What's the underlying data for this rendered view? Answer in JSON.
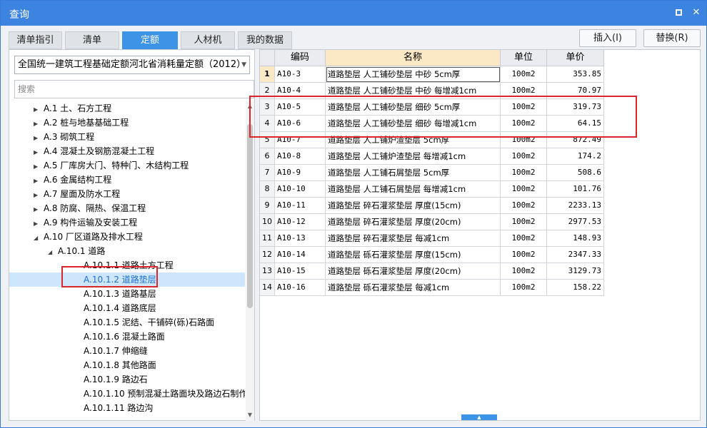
{
  "window": {
    "title": "查询"
  },
  "tabs": [
    {
      "label": "清单指引"
    },
    {
      "label": "清单"
    },
    {
      "label": "定额"
    },
    {
      "label": "人材机"
    },
    {
      "label": "我的数据"
    }
  ],
  "buttons": {
    "insert": "插入(I)",
    "replace": "替换(R)"
  },
  "left": {
    "combo_value": "全国统一建筑工程基础定额河北省消耗量定额（2012）",
    "search_placeholder": "搜索",
    "tree": [
      {
        "label": "A.1 土、石方工程",
        "expand": "collapsed"
      },
      {
        "label": "A.2 桩与地基基础工程",
        "expand": "collapsed"
      },
      {
        "label": "A.3 砌筑工程",
        "expand": "collapsed"
      },
      {
        "label": "A.4 混凝土及钢筋混凝土工程",
        "expand": "collapsed"
      },
      {
        "label": "A.5 厂库房大门、特种门、木结构工程",
        "expand": "collapsed"
      },
      {
        "label": "A.6 金属结构工程",
        "expand": "collapsed"
      },
      {
        "label": "A.7 屋面及防水工程",
        "expand": "collapsed"
      },
      {
        "label": "A.8 防腐、隔热、保温工程",
        "expand": "collapsed"
      },
      {
        "label": "A.9 构件运输及安装工程",
        "expand": "collapsed"
      },
      {
        "label": "A.10 厂区道路及排水工程",
        "expand": "expanded"
      },
      {
        "label": "A.10.1 道路",
        "expand": "expanded"
      },
      {
        "label": "A.10.1.1 道路土方工程",
        "expand": "none"
      },
      {
        "label": "A.10.1.2 道路垫层",
        "expand": "none",
        "selected": true
      },
      {
        "label": "A.10.1.3 道路基层",
        "expand": "none"
      },
      {
        "label": "A.10.1.4 道路底层",
        "expand": "none"
      },
      {
        "label": "A.10.1.5 泥结、干铺碎(砾)石路面",
        "expand": "none"
      },
      {
        "label": "A.10.1.6 混凝土路面",
        "expand": "none"
      },
      {
        "label": "A.10.1.7 伸缩缝",
        "expand": "none"
      },
      {
        "label": "A.10.1.8 其他路面",
        "expand": "none"
      },
      {
        "label": "A.10.1.9 路边石",
        "expand": "none"
      },
      {
        "label": "A.10.1.10 预制混凝土路面块及路边石制作",
        "expand": "none"
      },
      {
        "label": "A.10.1.11 路边沟",
        "expand": "none"
      }
    ]
  },
  "grid": {
    "headers": {
      "code": "编码",
      "name": "名称",
      "unit": "单位",
      "price": "单价"
    },
    "rows": [
      {
        "num": "1",
        "code": "A10-3",
        "name": "道路垫层 人工铺砂垫层 中砂 5cm厚",
        "unit": "100m2",
        "price": "353.85"
      },
      {
        "num": "2",
        "code": "A10-4",
        "name": "道路垫层 人工铺砂垫层 中砂 每增减1cm",
        "unit": "100m2",
        "price": "70.97"
      },
      {
        "num": "3",
        "code": "A10-5",
        "name": "道路垫层 人工铺砂垫层 细砂 5cm厚",
        "unit": "100m2",
        "price": "319.73"
      },
      {
        "num": "4",
        "code": "A10-6",
        "name": "道路垫层 人工铺砂垫层 细砂 每增减1cm",
        "unit": "100m2",
        "price": "64.15"
      },
      {
        "num": "5",
        "code": "A10-7",
        "name": "道路垫层 人工铺炉渣垫层 5cm厚",
        "unit": "100m2",
        "price": "872.49"
      },
      {
        "num": "6",
        "code": "A10-8",
        "name": "道路垫层 人工铺炉渣垫层 每增减1cm",
        "unit": "100m2",
        "price": "174.2"
      },
      {
        "num": "7",
        "code": "A10-9",
        "name": "道路垫层 人工铺石屑垫层 5cm厚",
        "unit": "100m2",
        "price": "508.6"
      },
      {
        "num": "8",
        "code": "A10-10",
        "name": "道路垫层 人工铺石屑垫层 每增减1cm",
        "unit": "100m2",
        "price": "101.76"
      },
      {
        "num": "9",
        "code": "A10-11",
        "name": "道路垫层 碎石灌浆垫层 厚度(15cm)",
        "unit": "100m2",
        "price": "2233.13"
      },
      {
        "num": "10",
        "code": "A10-12",
        "name": "道路垫层 碎石灌浆垫层 厚度(20cm)",
        "unit": "100m2",
        "price": "2977.53"
      },
      {
        "num": "11",
        "code": "A10-13",
        "name": "道路垫层 碎石灌浆垫层 每减1cm",
        "unit": "100m2",
        "price": "148.93"
      },
      {
        "num": "12",
        "code": "A10-14",
        "name": "道路垫层 砾石灌浆垫层 厚度(15cm)",
        "unit": "100m2",
        "price": "2347.33"
      },
      {
        "num": "13",
        "code": "A10-15",
        "name": "道路垫层 砾石灌浆垫层 厚度(20cm)",
        "unit": "100m2",
        "price": "3129.73"
      },
      {
        "num": "14",
        "code": "A10-16",
        "name": "道路垫层 砾石灌浆垫层 每减1cm",
        "unit": "100m2",
        "price": "158.22"
      }
    ]
  },
  "colors": {
    "accent": "#3d83e0",
    "highlight_red": "#d9262c",
    "header_highlight": "#fbe9c6"
  }
}
